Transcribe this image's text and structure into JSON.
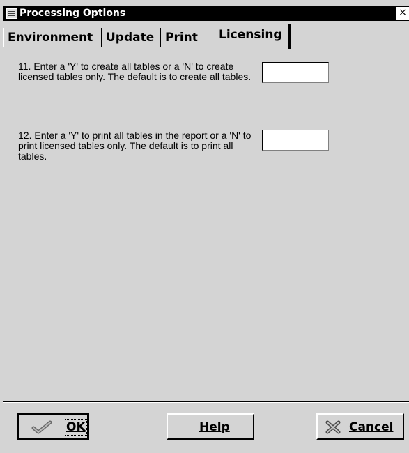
{
  "window": {
    "title": "Processing Options",
    "close_glyph": "×"
  },
  "tabs": [
    {
      "label": "Environment",
      "active": false
    },
    {
      "label": "Update",
      "active": false
    },
    {
      "label": "Print",
      "active": false
    },
    {
      "label": "Licensing",
      "active": true
    }
  ],
  "options": [
    {
      "text": "11.  Enter a 'Y' to create all tables or a 'N' to create licensed tables only.  The default is to create all tables.",
      "value": ""
    },
    {
      "text": "12.  Enter a 'Y' to print all tables in the report or a 'N' to print licensed tables only.  The default is to print all tables.",
      "value": ""
    }
  ],
  "buttons": {
    "ok_label": "OK",
    "help_label": "Help",
    "cancel_label": "Cancel"
  },
  "icons": {
    "window_icon": "window-icon",
    "ok_icon": "checkmark-icon",
    "cancel_icon": "x-mark-icon"
  },
  "colors": {
    "titlebar": "#000000",
    "background": "#d4d4d4"
  }
}
